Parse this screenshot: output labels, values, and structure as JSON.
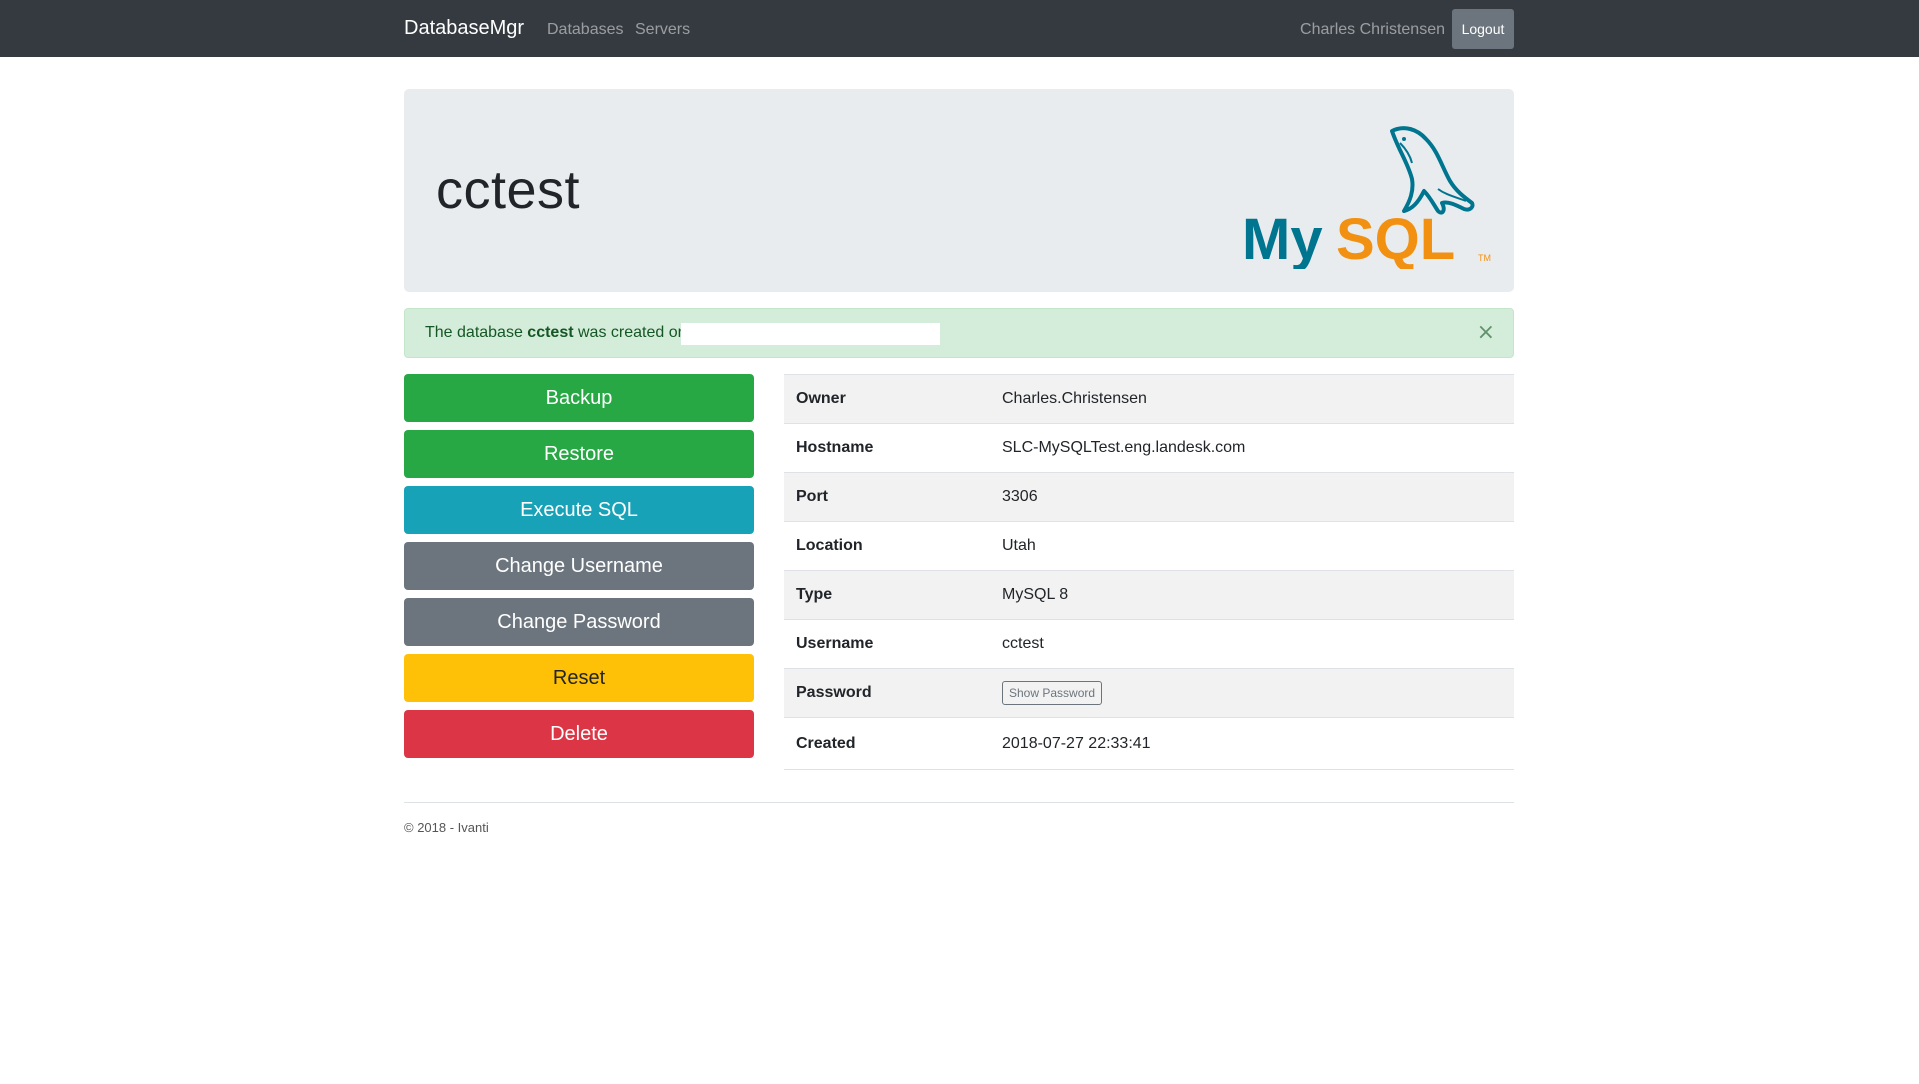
{
  "navbar": {
    "brand": "DatabaseMgr",
    "links": [
      {
        "label": "Databases"
      },
      {
        "label": "Servers"
      }
    ],
    "user_name": "Charles Christensen",
    "logout_label": "Logout"
  },
  "jumbotron": {
    "title": "cctest",
    "logo": {
      "text": "MySQL",
      "trademark": "TM",
      "icon": "mysql-dolphin-logo"
    }
  },
  "alert": {
    "prefix": "The database ",
    "db_name": "cctest",
    "suffix": " was created on",
    "close_glyph": "×"
  },
  "actions": [
    {
      "label": "Backup",
      "style": "success"
    },
    {
      "label": "Restore",
      "style": "success"
    },
    {
      "label": "Execute SQL",
      "style": "info"
    },
    {
      "label": "Change Username",
      "style": "secondary"
    },
    {
      "label": "Change Password",
      "style": "secondary"
    },
    {
      "label": "Reset",
      "style": "warning"
    },
    {
      "label": "Delete",
      "style": "danger"
    }
  ],
  "details": [
    {
      "label": "Owner",
      "value": "Charles.Christensen"
    },
    {
      "label": "Hostname",
      "value": "SLC-MySQLTest.eng.landesk.com"
    },
    {
      "label": "Port",
      "value": "3306"
    },
    {
      "label": "Location",
      "value": "Utah"
    },
    {
      "label": "Type",
      "value": "MySQL 8"
    },
    {
      "label": "Username",
      "value": "cctest"
    },
    {
      "label": "Password",
      "button": "Show Password"
    },
    {
      "label": "Created",
      "value": "2018-07-27 22:33:41"
    }
  ],
  "footer": {
    "text": "© 2018 - Ivanti"
  },
  "colors": {
    "navbar": "#343a40",
    "success": "#28a745",
    "info": "#17a2b8",
    "secondary": "#6c757d",
    "warning": "#ffc107",
    "danger": "#dc3545",
    "alert_bg": "#d4edda",
    "mysql_blue": "#00758f",
    "mysql_orange": "#f29111"
  }
}
